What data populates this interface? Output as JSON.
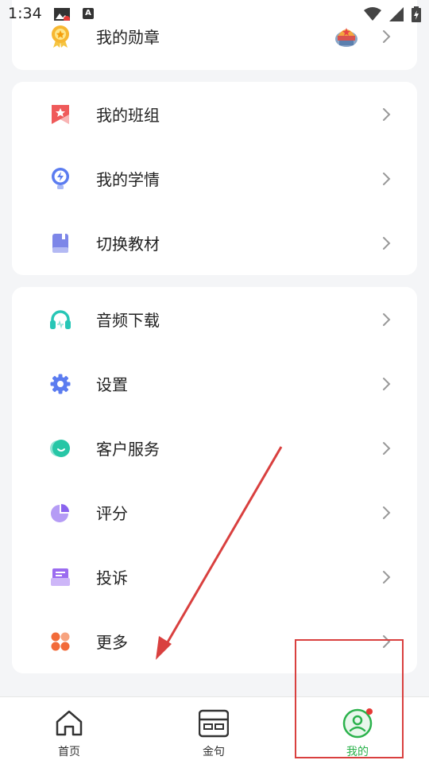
{
  "status_bar": {
    "time": "1:34"
  },
  "menu_group_1": [
    {
      "label": "我的勋章",
      "icon": "medal-icon"
    }
  ],
  "menu_group_2": [
    {
      "label": "我的班组",
      "icon": "class-flag-icon"
    },
    {
      "label": "我的学情",
      "icon": "lightbulb-icon"
    },
    {
      "label": "切换教材",
      "icon": "textbook-icon"
    }
  ],
  "menu_group_3": [
    {
      "label": "音频下载",
      "icon": "headphones-icon"
    },
    {
      "label": "设置",
      "icon": "gear-icon"
    },
    {
      "label": "客户服务",
      "icon": "customer-service-icon"
    },
    {
      "label": "评分",
      "icon": "rating-icon"
    },
    {
      "label": "投诉",
      "icon": "complaint-icon"
    },
    {
      "label": "更多",
      "icon": "more-icon"
    }
  ],
  "tab_bar": {
    "home": "首页",
    "quotes": "金句",
    "mine": "我的"
  },
  "colors": {
    "active_tab": "#2bb24c",
    "annotation": "#d9403f"
  }
}
